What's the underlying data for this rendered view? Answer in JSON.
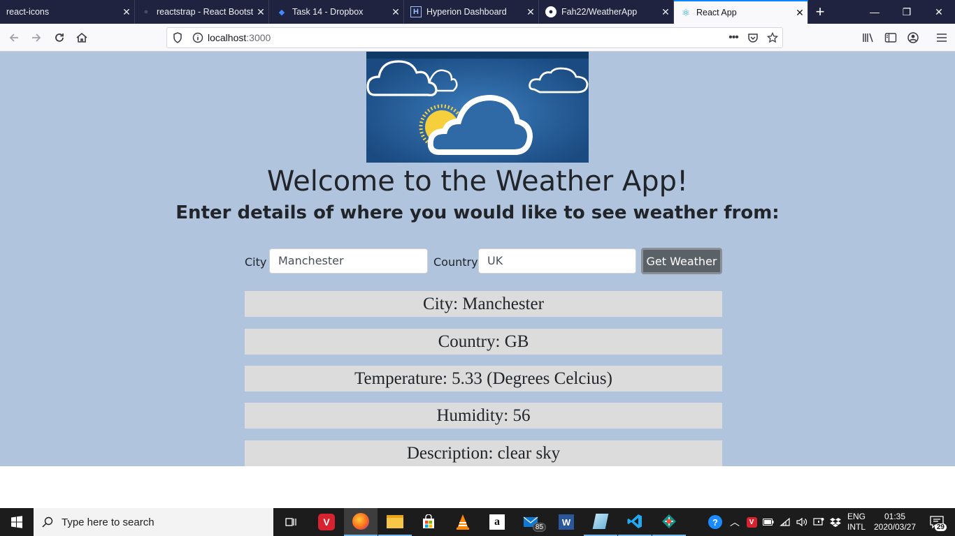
{
  "browser": {
    "tabs": [
      {
        "title": "react-icons",
        "active": false
      },
      {
        "title": "reactstrap - React Bootst",
        "active": false
      },
      {
        "title": "Task 14 - Dropbox",
        "active": false
      },
      {
        "title": "Hyperion Dashboard",
        "active": false
      },
      {
        "title": "Fah22/WeatherApp",
        "active": false
      },
      {
        "title": "React App",
        "active": true
      }
    ],
    "url_host": "localhost",
    "url_port": ":3000"
  },
  "page": {
    "heading": "Welcome to the Weather App!",
    "subheading": "Enter details of where you would like to see weather from:",
    "city_label": "City",
    "city_value": "Manchester",
    "country_label": "Country",
    "country_value": "UK",
    "submit_label": "Get Weather",
    "results": {
      "city": "City: Manchester",
      "country": "Country: GB",
      "temperature": "Temperature: 5.33 (Degrees Celcius)",
      "humidity": "Humidity: 56",
      "description": "Description: clear sky"
    },
    "background_color": "#b0c4de"
  },
  "taskbar": {
    "search_placeholder": "Type here to search",
    "mail_badge": "85",
    "language": "ENG",
    "layout": "INTL",
    "time": "01:35",
    "date": "2020/03/27",
    "notification_count": "29"
  }
}
